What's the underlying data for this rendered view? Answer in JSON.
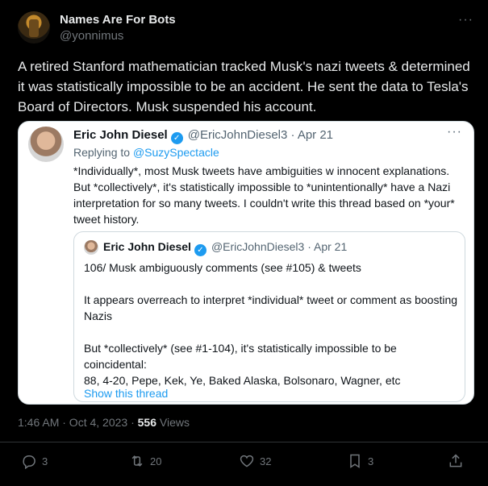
{
  "tweet": {
    "author_name": "Names Are For Bots",
    "author_handle": "@yonnimus",
    "more": "···",
    "text": "A retired Stanford mathematician tracked Musk's nazi tweets & determined it was statistically impossible to be an accident. He sent the data to Tesla's Board of Directors. Musk suspended his account."
  },
  "quoted_tweet": {
    "author_name": "Eric John Diesel",
    "verified_icon": "verified-badge-icon",
    "handle_date": "@EricJohnDiesel3 · Apr 21",
    "more": "···",
    "replying_prefix": "Replying to ",
    "replying_to": "@SuzySpectacle",
    "text": "*Individually*, most Musk tweets have ambiguities w innocent explanations. But *collectively*, it's statistically impossible to *unintentionally* have a Nazi interpretation for so many tweets. I couldn't write this thread based on *your* tweet history.",
    "inner": {
      "author_name": "Eric John Diesel",
      "handle_date": "@EricJohnDiesel3 · Apr 21",
      "p1": "106/ Musk ambiguously comments (see #105) & tweets",
      "p2": "It appears overreach to interpret *individual* tweet or comment as boosting Nazis",
      "p3": "But *collectively* (see #1-104), it's statistically impossible to be coincidental:",
      "p4": "88, 4-20, Pepe, Kek, Ye, Baked Alaska, Bolsonaro, Wagner, etc",
      "show_thread": "Show this thread"
    }
  },
  "meta": {
    "timestamp": "1:46 AM · Oct 4, 2023 · ",
    "views_count": "556",
    "views_label": " Views"
  },
  "actions": {
    "replies": "3",
    "retweets": "20",
    "likes": "32",
    "bookmarks": "3"
  },
  "colors": {
    "background": "#000000",
    "accent": "#1d9bf0",
    "muted": "#71767b"
  }
}
